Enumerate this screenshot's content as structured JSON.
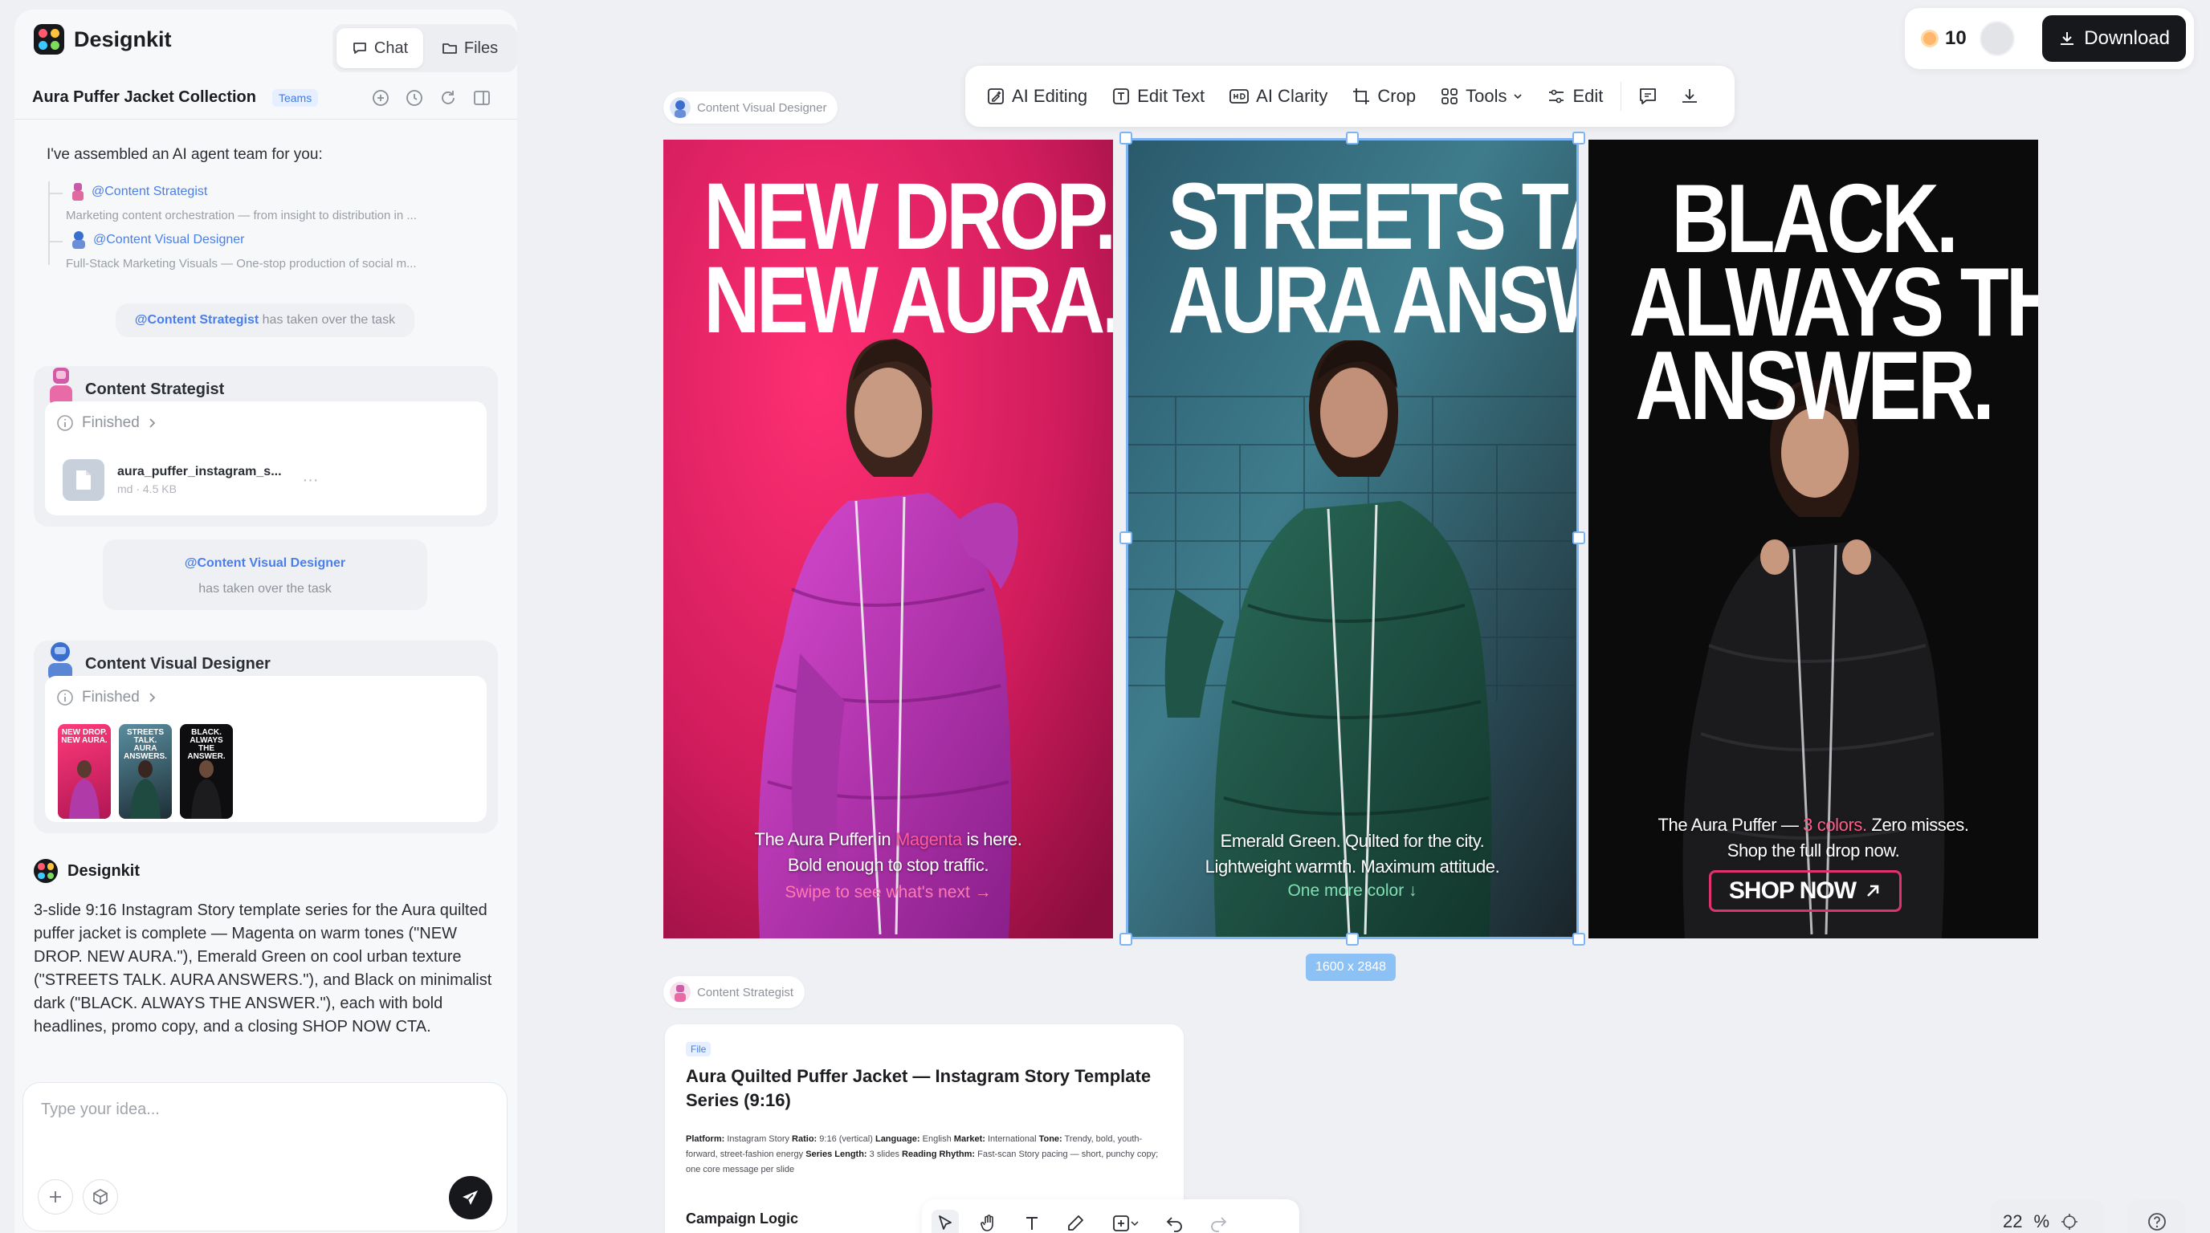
{
  "app": {
    "name": "Designkit",
    "tabs": {
      "chat": "Chat",
      "files": "Files"
    }
  },
  "project": {
    "title": "Aura Puffer Jacket Collection",
    "badge": "Teams"
  },
  "chat": {
    "intro": "I've assembled an AI agent team for you:",
    "agents": [
      {
        "handle": "@Content Strategist",
        "desc": "Marketing content orchestration — from insight to distribution in ..."
      },
      {
        "handle": "@Content Visual Designer",
        "desc": "Full-Stack Marketing Visuals — One-stop production of social m..."
      }
    ],
    "handoff1": {
      "handle": "@Content Strategist",
      "text": "has taken over the task"
    },
    "strategist_card": {
      "name": "Content Strategist",
      "status": "Finished",
      "file_name": "aura_puffer_instagram_s...",
      "file_meta": "md · 4.5 KB",
      "more": "···"
    },
    "handoff2": {
      "handle": "@Content Visual Designer",
      "text": "has taken over the task"
    },
    "designer_card": {
      "name": "Content Visual Designer",
      "status": "Finished",
      "thumbs": [
        "NEW DROP. NEW AURA.",
        "STREETS TALK. AURA ANSWERS.",
        "BLACK. ALWAYS THE ANSWER."
      ]
    },
    "final": {
      "name": "Designkit",
      "text": "3-slide 9:16 Instagram Story template series for the Aura quilted puffer jacket is complete — Magenta on warm tones (\"NEW DROP. NEW AURA.\"), Emerald Green on cool urban texture (\"STREETS TALK. AURA ANSWERS.\"), and Black on minimalist dark (\"BLACK. ALWAYS THE ANSWER.\"), each with bold headlines, promo copy, and a closing SHOP NOW CTA."
    },
    "input_placeholder": "Type your idea..."
  },
  "toolbar": {
    "ai_editing": "AI Editing",
    "edit_text": "Edit Text",
    "ai_clarity": "AI Clarity",
    "crop": "Crop",
    "tools": "Tools",
    "edit": "Edit"
  },
  "top_right": {
    "credits": "10",
    "download": "Download"
  },
  "canvas": {
    "designer_tag": "Content Visual Designer",
    "strategist_tag": "Content Strategist",
    "size_badge": "1600 x 2848",
    "slides": [
      {
        "headline_1": "NEW DROP.",
        "headline_2": "NEW AURA.",
        "copy_pre": "The Aura Puffer in ",
        "copy_highlight": "Magenta",
        "copy_post": " is here.",
        "copy_2": "Bold enough to stop traffic.",
        "cta": "Swipe to see what's next →",
        "bg": "#d2205d"
      },
      {
        "headline_1": "STREETS TALK.",
        "headline_2": "AURA ANSWERS.",
        "copy_1": "Emerald Green. Quilted for the city.",
        "copy_2": "Lightweight warmth. Maximum attitude.",
        "cta": "One more color ↓",
        "bg": "#2f4f5a"
      },
      {
        "headline_1": "BLACK.",
        "headline_2": "ALWAYS THE",
        "headline_3": "ANSWER.",
        "copy_pre": "The Aura Puffer — ",
        "copy_highlight": "3 colors.",
        "copy_post": " Zero misses.",
        "copy_2": "Shop the full drop now.",
        "button": "SHOP NOW",
        "bg": "#0d0d0e"
      }
    ],
    "doc": {
      "badge": "File",
      "title": "Aura Quilted Puffer Jacket — Instagram Story Template Series (9:16)",
      "meta": [
        {
          "k": "Platform:",
          "v": " Instagram Story "
        },
        {
          "k": "Ratio:",
          "v": " 9:16 (vertical) "
        },
        {
          "k": "Language:",
          "v": " English "
        },
        {
          "k": "Market:",
          "v": " International "
        },
        {
          "k": "Tone:",
          "v": " Trendy, bold, youth-forward, street-fashion energy "
        },
        {
          "k": "Series Length:",
          "v": " 3 slides "
        },
        {
          "k": "Reading Rhythm:",
          "v": " Fast-scan Story pacing — short, punchy copy; one core message per slide"
        }
      ],
      "section": "Campaign Logic"
    },
    "zoom": {
      "value": "22",
      "unit": "%"
    }
  },
  "colors": {
    "accent_blue": "#4a7ee8",
    "magenta_highlight": "#ff5aa0",
    "green_cta": "#7fe0b4",
    "pink_cta": "#ff7ab0",
    "selection": "#7cb5f2"
  }
}
